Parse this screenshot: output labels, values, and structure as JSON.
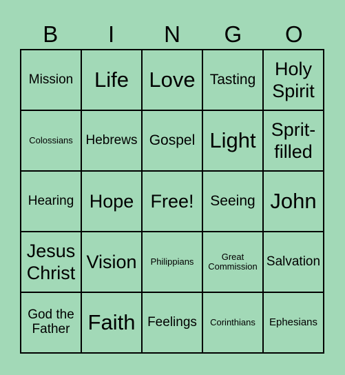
{
  "header": [
    "B",
    "I",
    "N",
    "G",
    "O"
  ],
  "cells": [
    {
      "text": "Mission",
      "size": "s18"
    },
    {
      "text": "Life",
      "size": "s30"
    },
    {
      "text": "Love",
      "size": "s30"
    },
    {
      "text": "Tasting",
      "size": "s20"
    },
    {
      "text": "Holy Spirit",
      "size": "s27"
    },
    {
      "text": "Colossians",
      "size": "s13"
    },
    {
      "text": "Hebrews",
      "size": "s18"
    },
    {
      "text": "Gospel",
      "size": "s20"
    },
    {
      "text": "Light",
      "size": "s30"
    },
    {
      "text": "Sprit-filled",
      "size": "s27"
    },
    {
      "text": "Hearing",
      "size": "s18"
    },
    {
      "text": "Hope",
      "size": "s27"
    },
    {
      "text": "Free!",
      "size": "s27"
    },
    {
      "text": "Seeing",
      "size": "s20"
    },
    {
      "text": "John",
      "size": "s30"
    },
    {
      "text": "Jesus Christ",
      "size": "s27"
    },
    {
      "text": "Vision",
      "size": "s27"
    },
    {
      "text": "Philippians",
      "size": "s13"
    },
    {
      "text": "Great Commission",
      "size": "s13"
    },
    {
      "text": "Salvation",
      "size": "s18"
    },
    {
      "text": "God the Father",
      "size": "s18"
    },
    {
      "text": "Faith",
      "size": "s30"
    },
    {
      "text": "Feelings",
      "size": "s18"
    },
    {
      "text": "Corinthians",
      "size": "s13"
    },
    {
      "text": "Ephesians",
      "size": "s15"
    }
  ]
}
